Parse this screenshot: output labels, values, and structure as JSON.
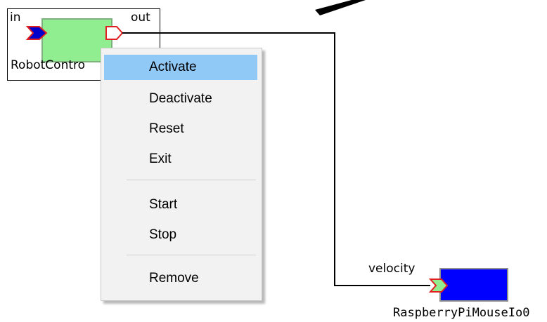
{
  "canvas": {
    "components": [
      {
        "name": "RobotControl",
        "display_label": "RobotContro",
        "state_color": "#90ee90",
        "ports": {
          "inport_label": "in",
          "outport_label": "out"
        }
      },
      {
        "name": "RaspberryPiMouseIo0",
        "display_label": "RaspberryPiMouseIo0",
        "state_color": "#0000ff",
        "ports": {
          "inport_label": "velocity"
        }
      }
    ]
  },
  "context_menu": {
    "items": [
      {
        "label": "Activate",
        "highlighted": true
      },
      {
        "label": "Deactivate",
        "highlighted": false
      },
      {
        "label": "Reset",
        "highlighted": false
      },
      {
        "label": "Exit",
        "highlighted": false
      }
    ],
    "items_group2": [
      {
        "label": "Start",
        "highlighted": false
      },
      {
        "label": "Stop",
        "highlighted": false
      }
    ],
    "items_group3": [
      {
        "label": "Remove",
        "highlighted": false
      }
    ]
  },
  "colors": {
    "port_red": "#e02020",
    "port_blue": "#0000cc",
    "inactive_green": "#90ee90",
    "menu_highlight": "#90c8f6"
  }
}
